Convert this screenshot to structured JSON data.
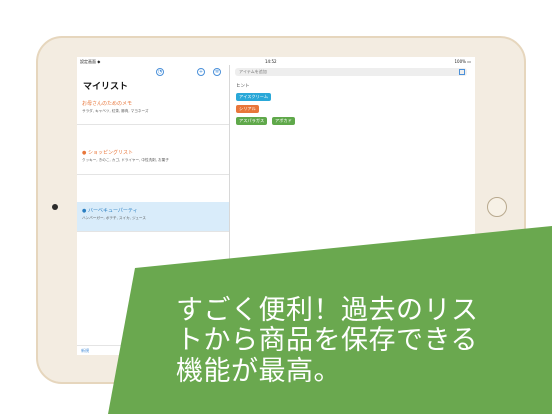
{
  "status": {
    "left": "設定画面 ◆",
    "time": "14:52",
    "battery": "100% ▭"
  },
  "master": {
    "title": "マイリスト",
    "items": [
      {
        "title": "お母さんのためのメモ",
        "subtitle": "サラダ, キャベツ, 紅茶, 豚肉, マヨネーズ"
      },
      {
        "title": "●  ショッピングリスト",
        "subtitle": "クッキー, きのこ, カゴ, ドライヤー, 中性洗剤, お菓子"
      },
      {
        "title": "●  バーベキューパーティ",
        "subtitle": "ハンバーガー, ポテチ, スイカ, ジュース"
      }
    ],
    "bottom_label": "新規"
  },
  "detail": {
    "search_placeholder": "アイテムを追加",
    "hint_label": "ヒント",
    "chips": [
      {
        "label": "アイスクリーム",
        "color": "#2aa8d8"
      },
      {
        "label": "シリアル",
        "color": "#e8763a"
      },
      {
        "label": "アスパラガス",
        "color": "#5fa84a"
      },
      {
        "label": "アボカド",
        "color": "#5fa84a"
      }
    ]
  },
  "caption": {
    "line1": "すごく便利！過去のリス",
    "line2": "トから商品を保存できる",
    "line3": "機能が最高。",
    "quote_mark": "“"
  },
  "colors": {
    "banner": "#6aa84f",
    "accent": "#4a90d9",
    "frame": "#f3ece1"
  }
}
